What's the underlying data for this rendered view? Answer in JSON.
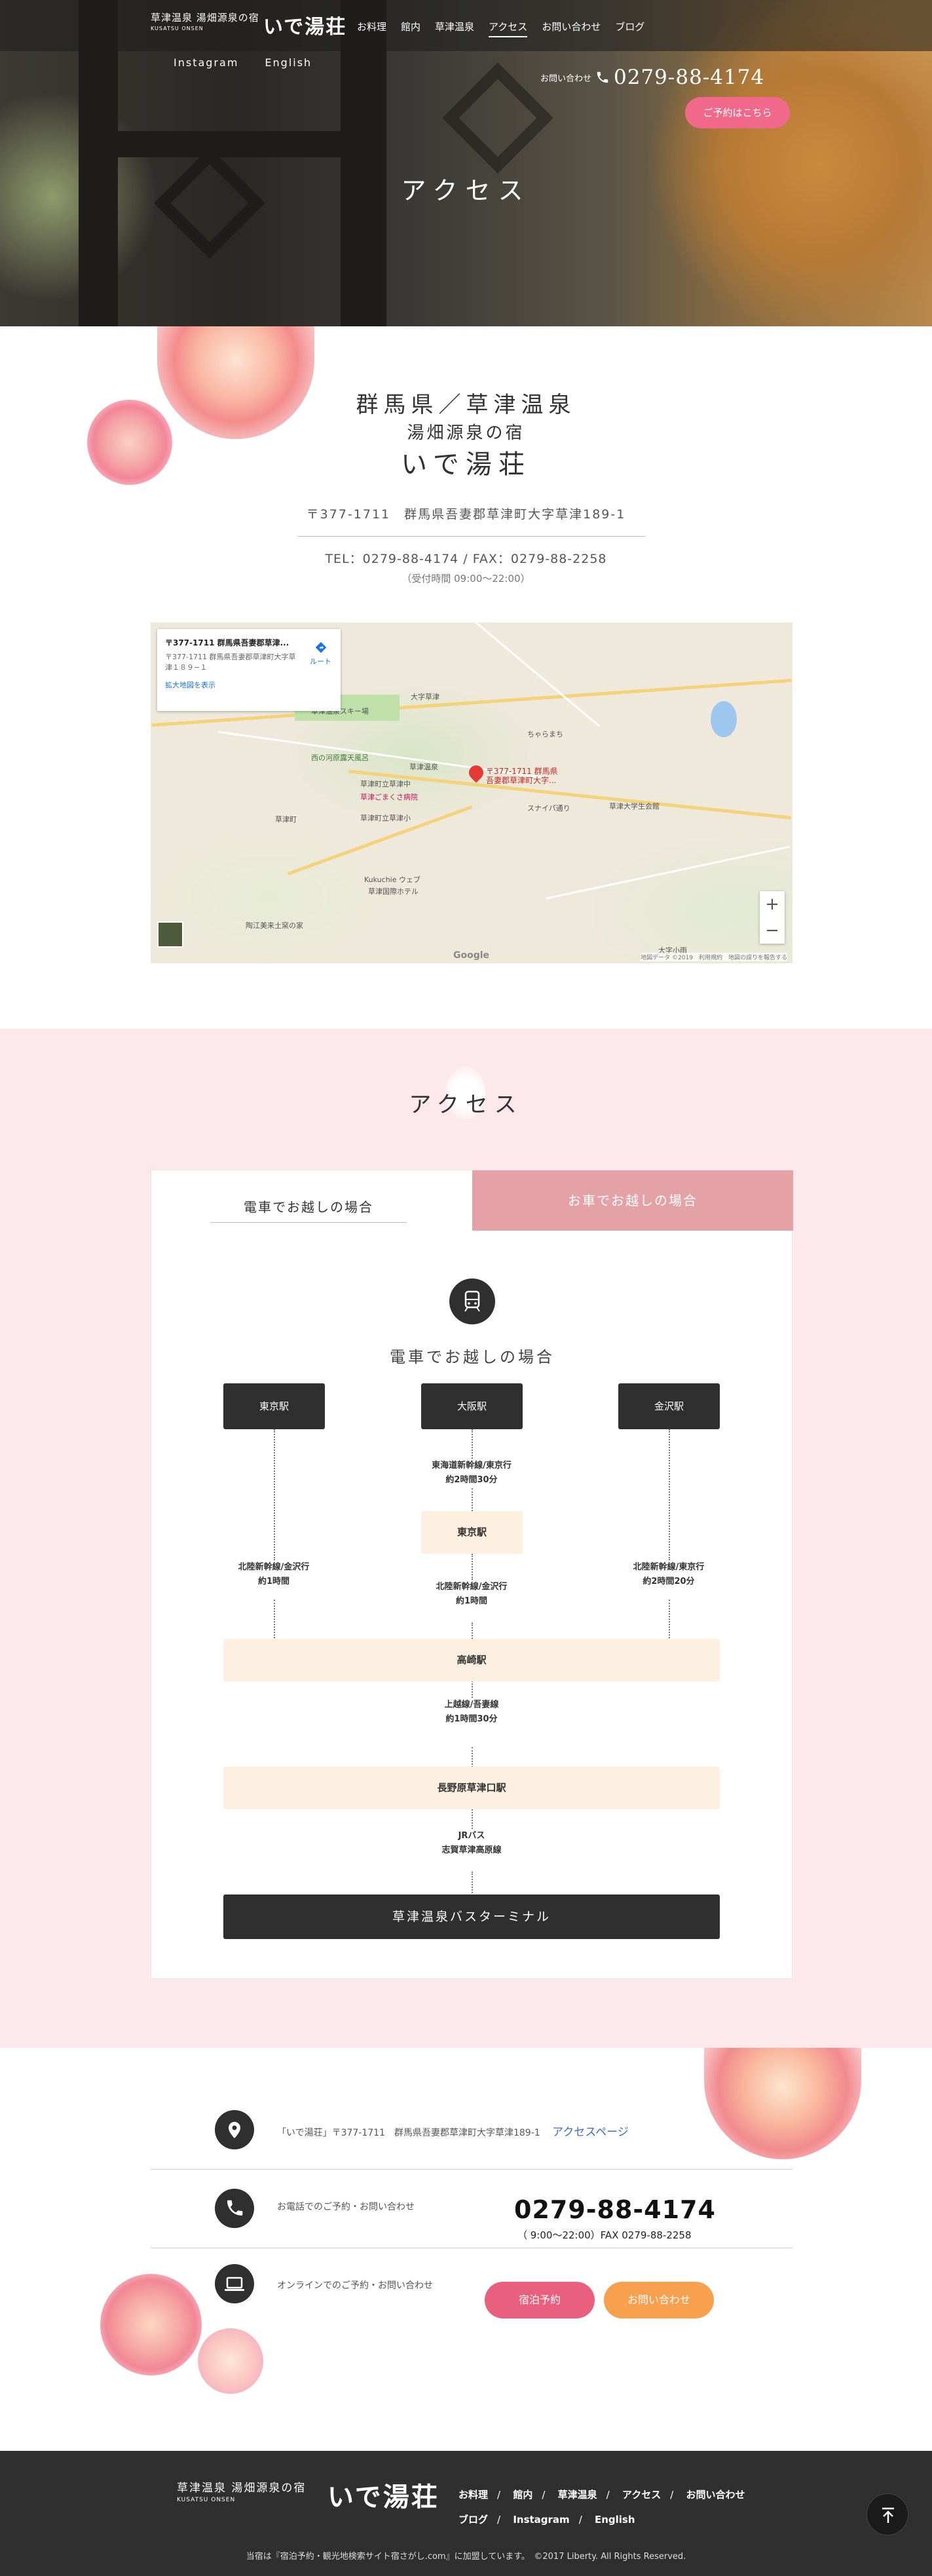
{
  "header": {
    "logo_line1": "草津温泉 湯畑源泉の宿",
    "logo_line2": "KUSATSU ONSEN",
    "logo_name": "いで湯荘",
    "nav": [
      "お料理",
      "館内",
      "草津温泉",
      "アクセス",
      "お問い合わせ",
      "ブログ"
    ],
    "active_nav": "アクセス",
    "subnav": [
      "Instagram",
      "English"
    ],
    "phone_label": "お問い合わせ",
    "phone": "0279-88-4174",
    "reserve_button": "ご予約はこちら"
  },
  "hero": {
    "title": "アクセス"
  },
  "info": {
    "prefecture": "群馬県／草津温泉",
    "ryokan_type": "湯畑源泉の宿",
    "name": "いで湯荘",
    "address": "〒377-1711　群馬県吾妻郡草津町大字草津189-1",
    "tel_fax": "TEL：0279-88-4174 / FAX：0279-88-2258",
    "hours": "（受付時間 09:00～22:00）"
  },
  "map": {
    "card_title": "〒377-1711 群馬県吾妻郡草津...",
    "card_address": "〒377-1711 群馬県吾妻郡草津町大字草津１８９−１",
    "card_link": "拡大地図を表示",
    "route_label": "ルート",
    "pin_label": "〒377-1711 群馬県吾妻郡草津町大字...",
    "labels": [
      "草津温泉スキー場",
      "西の河原露天風呂",
      "草津町立草津中",
      "草津ごまくさ病院",
      "草津町立草津小",
      "草津町",
      "ちゃらまち",
      "草津温泉",
      "スナイパ通り",
      "草津大学生会館",
      "大字小雨",
      "Kukuchie ウェブ",
      "草津国際ホテル",
      "陶江美来土窯の家",
      "大字草津"
    ],
    "zoom_in": "+",
    "zoom_out": "−",
    "google": "Google",
    "credit": "地図データ ©2019　利用規約　地図の誤りを報告する"
  },
  "access": {
    "title": "アクセス",
    "tab_train": "電車でお越しの場合",
    "tab_car": "お車でお越しの場合",
    "train_heading": "電車でお越しの場合",
    "stations_top": [
      "東京駅",
      "大阪駅",
      "金沢駅"
    ],
    "osaka_note": [
      "東海道新幹線/東京行",
      "約2時間30分"
    ],
    "tokyo_mid": "東京駅",
    "tokyo_note": [
      "北陸新幹線/金沢行",
      "約1時間"
    ],
    "tokyo_mid_note": [
      "北陸新幹線/金沢行",
      "約1時間"
    ],
    "kanazawa_note": [
      "北陸新幹線/東京行",
      "約2時間20分"
    ],
    "takasaki": "高崎駅",
    "takasaki_note": [
      "上越線/吾妻線",
      "約1時間30分"
    ],
    "naganohara": "長野原草津口駅",
    "naganohara_note": [
      "JRバス",
      "志賀草津高原線"
    ],
    "terminal": "草津温泉バスターミナル"
  },
  "contact": {
    "address_text": "「いで湯荘」〒377-1711　群馬県吾妻郡草津町大字草津189-1",
    "access_link": "アクセスページ",
    "phone_label": "お電話でのご予約・お問い合わせ",
    "phone": "0279-88-4174",
    "phone_hours": "（ 9:00～22:00）FAX 0279-88-2258",
    "online_label": "オンラインでのご予約・お問い合わせ",
    "book_button": "宿泊予約",
    "inquiry_button": "お問い合わせ"
  },
  "footer": {
    "logo_line1": "草津温泉 湯畑源泉の宿",
    "logo_line2": "KUSATSU ONSEN",
    "logo_name": "いで湯荘",
    "nav_row1": [
      "お料理",
      "館内",
      "草津温泉",
      "アクセス",
      "お問い合わせ"
    ],
    "nav_row2": [
      "ブログ",
      "Instagram",
      "English"
    ],
    "copyright": "当宿は『宿泊予約・観光地検索サイト宿さがし.com』に加盟しています。　©2017 Liberty. All Rights Reserved."
  },
  "colors": {
    "accent_pink": "#f0688a",
    "tab_pink": "#e4a2a7",
    "section_bg": "#fde9ec",
    "box_beige": "#fdf0e1",
    "dark": "#2f2f2f",
    "orange": "#f7a04d"
  }
}
